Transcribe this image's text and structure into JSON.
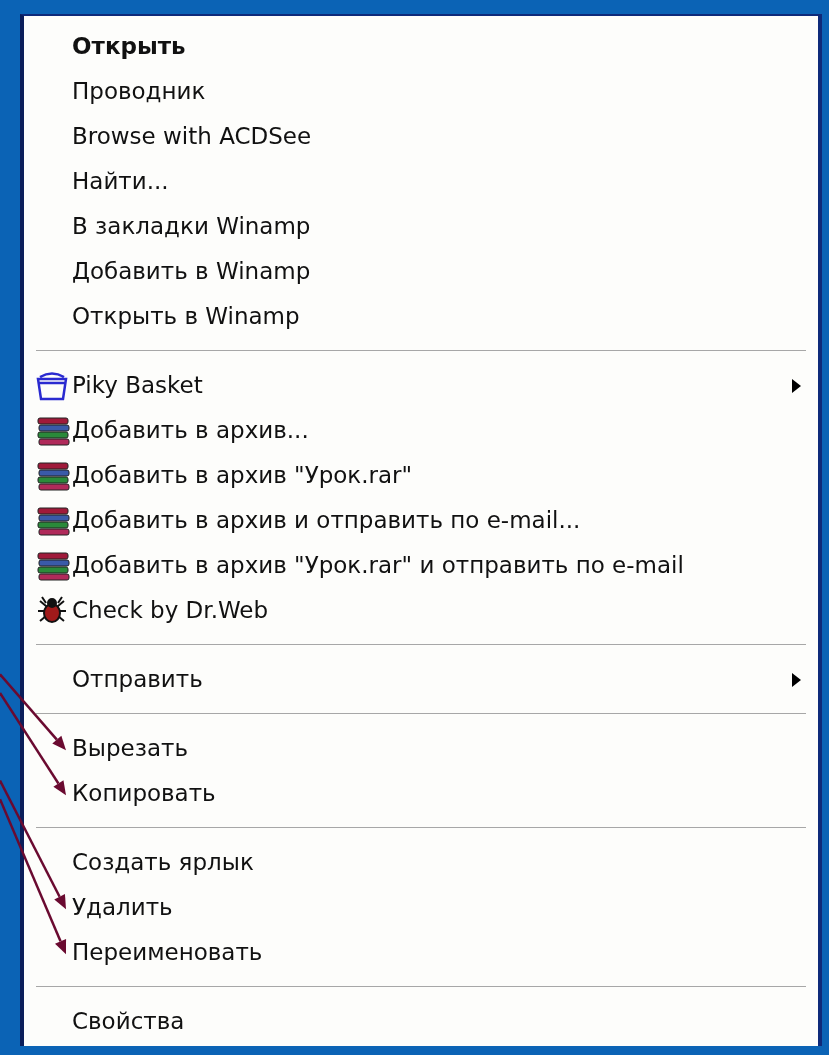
{
  "context_menu": {
    "sections": [
      {
        "items": [
          {
            "label": "Открыть",
            "default": true
          },
          {
            "label": "Проводник",
            "default": false
          },
          {
            "label": "Browse with ACDSee",
            "default": false
          },
          {
            "label": "Найти...",
            "default": false
          },
          {
            "label": "В закладки Winamp",
            "default": false
          },
          {
            "label": "Добавить в Winamp",
            "default": false
          },
          {
            "label": "Открыть в Winamp",
            "default": false
          }
        ]
      },
      {
        "items": [
          {
            "label": "Piky Basket",
            "kind": "basket",
            "submenu": true
          },
          {
            "label": "Добавить в архив...",
            "kind": "archive"
          },
          {
            "label": "Добавить в архив \"Урок.rar\"",
            "kind": "archive"
          },
          {
            "label": "Добавить в архив и отправить по e-mail...",
            "kind": "archive"
          },
          {
            "label": "Добавить в архив \"Урок.rar\" и отправить по e-mail",
            "kind": "archive"
          },
          {
            "label": "Check by Dr.Web",
            "kind": "scanner"
          }
        ]
      },
      {
        "items": [
          {
            "label": "Отправить",
            "submenu": true
          }
        ]
      },
      {
        "items": [
          {
            "label": "Вырезать",
            "arrow": true
          },
          {
            "label": "Копировать",
            "arrow": true
          }
        ]
      },
      {
        "items": [
          {
            "label": "Создать ярлык",
            "arrow": false
          },
          {
            "label": "Удалить",
            "arrow": true
          },
          {
            "label": "Переименовать",
            "arrow": true
          }
        ]
      },
      {
        "items": [
          {
            "label": "Свойства"
          }
        ]
      }
    ]
  }
}
